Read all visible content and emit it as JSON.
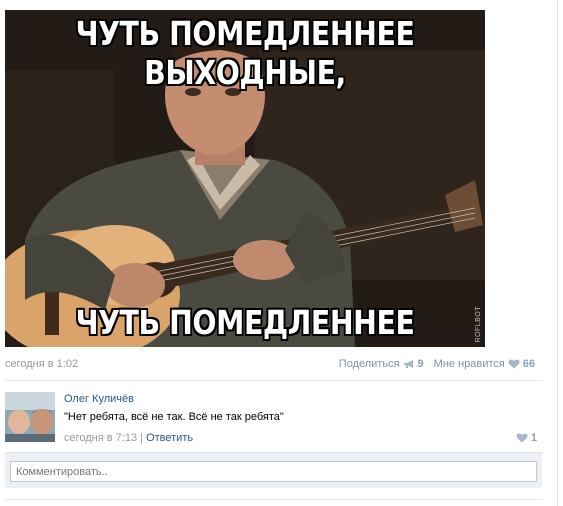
{
  "meme": {
    "top_caption": "ЧУТЬ ПОМЕДЛЕННЕЕ ВЫХОДНЫЕ,",
    "bottom_caption": "ЧУТЬ ПОМЕДЛЕННЕЕ",
    "watermark": "ROFLBOT"
  },
  "post": {
    "time": "сегодня в 1:02",
    "share_label": "Поделиться",
    "share_count": "9",
    "like_label": "Мне нравится",
    "like_count": "66"
  },
  "comment": {
    "author": "Олег Куличёв",
    "text": "\"Нет ребята, всё не так. Всё не так ребята\"",
    "time": "сегодня в 7:13",
    "separator": "|",
    "reply_label": "Ответить",
    "like_count": "1"
  },
  "compose": {
    "placeholder": "Комментировать.."
  },
  "colors": {
    "link": "#2b587a",
    "muted": "#999999",
    "action": "#7c91a8"
  }
}
